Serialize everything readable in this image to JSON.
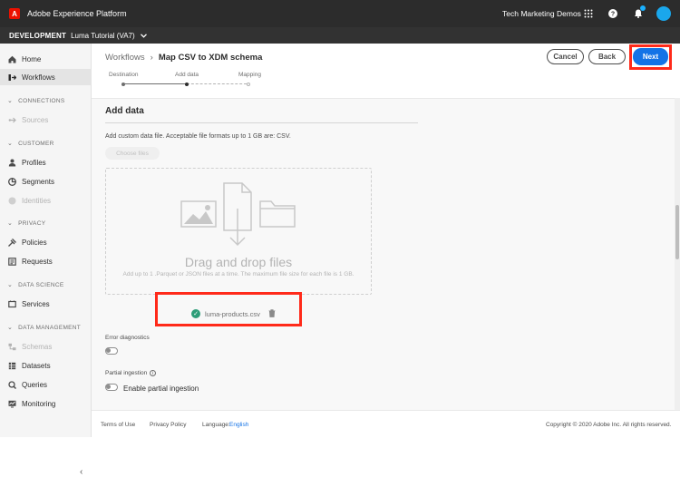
{
  "topbar": {
    "app_title": "Adobe Experience Platform",
    "org": "Tech Marketing Demos",
    "logo_letter": "A"
  },
  "envbar": {
    "environment": "DEVELOPMENT",
    "sandbox": "Luma Tutorial (VA7)"
  },
  "sidebar": {
    "items": [
      {
        "label": "Home",
        "icon": "home-icon"
      },
      {
        "label": "Workflows",
        "icon": "workflows-icon"
      },
      {
        "label": "Sources",
        "icon": "sources-icon"
      },
      {
        "label": "Profiles",
        "icon": "profiles-icon"
      },
      {
        "label": "Segments",
        "icon": "segments-icon"
      },
      {
        "label": "Identities",
        "icon": "identities-icon"
      },
      {
        "label": "Policies",
        "icon": "policies-icon"
      },
      {
        "label": "Requests",
        "icon": "requests-icon"
      },
      {
        "label": "Services",
        "icon": "services-icon"
      },
      {
        "label": "Schemas",
        "icon": "schemas-icon"
      },
      {
        "label": "Datasets",
        "icon": "datasets-icon"
      },
      {
        "label": "Queries",
        "icon": "queries-icon"
      },
      {
        "label": "Monitoring",
        "icon": "monitoring-icon"
      }
    ],
    "sections": {
      "connections": "CONNECTIONS",
      "customer": "CUSTOMER",
      "privacy": "PRIVACY",
      "data_science": "DATA SCIENCE",
      "data_management": "DATA MANAGEMENT"
    }
  },
  "breadcrumb": {
    "parent": "Workflows",
    "sep": "›",
    "current": "Map CSV to XDM schema"
  },
  "actions": {
    "cancel": "Cancel",
    "back": "Back",
    "next": "Next"
  },
  "steps": [
    "Destination",
    "Add data",
    "Mapping"
  ],
  "content": {
    "title": "Add data",
    "description": "Add custom data file. Acceptable file formats up to 1 GB are: CSV.",
    "choose_files": "Choose files",
    "drop_title": "Drag and drop files",
    "drop_sub": "Add up to 1 .Parquet or JSON files at a time. The maximum file size for each file is 1 GB.",
    "file_name": "luma-products.csv",
    "error_diagnostics": "Error diagnostics",
    "partial_ingestion": "Partial ingestion",
    "enable_partial": "Enable partial ingestion"
  },
  "footer": {
    "terms": "Terms of Use",
    "privacy": "Privacy Policy",
    "language_label": "Language:",
    "language": "English",
    "copyright": "Copyright © 2020 Adobe Inc. All rights reserved."
  },
  "colors": {
    "accent": "#1473e6",
    "highlight": "#ff2a1a",
    "success": "#2d9d78"
  }
}
